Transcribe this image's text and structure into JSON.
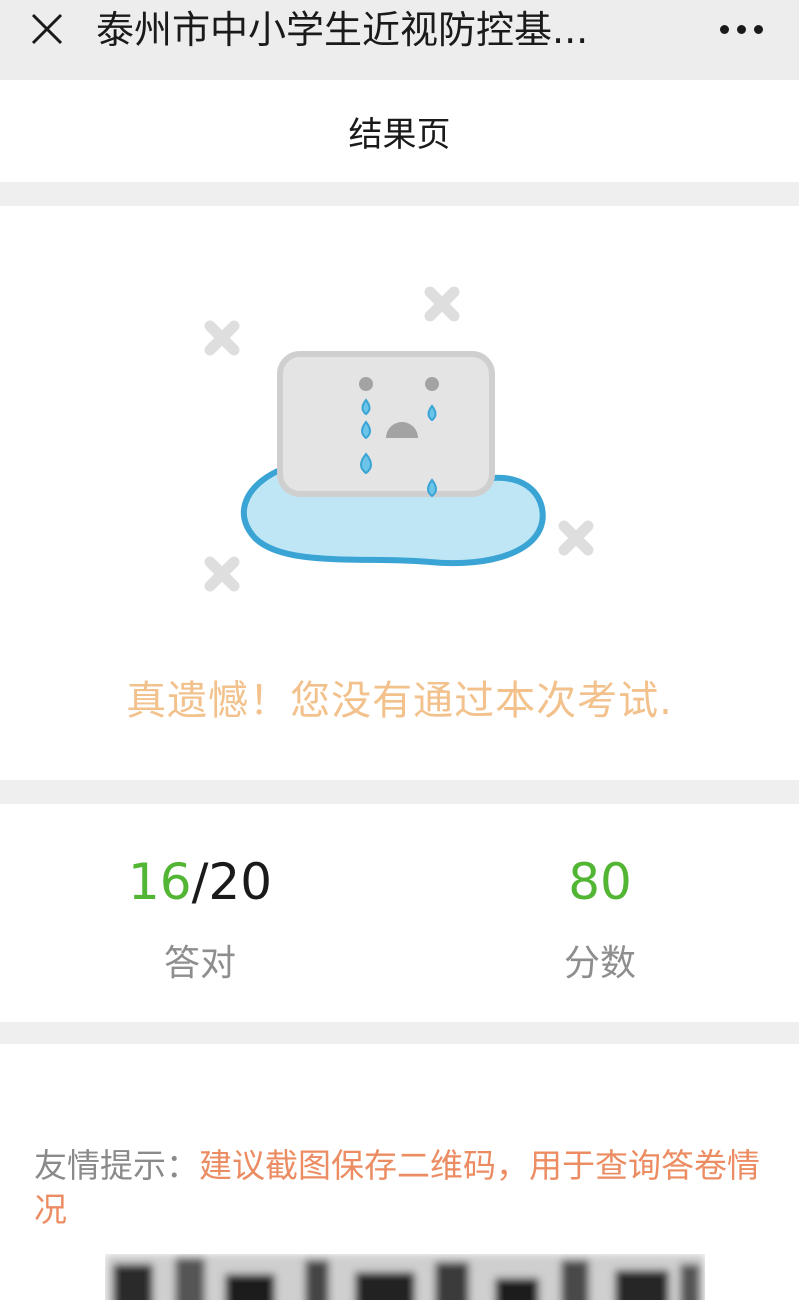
{
  "window": {
    "title": "泰州市中小学生近视防控基..."
  },
  "nav": {
    "title": "结果页"
  },
  "result": {
    "message": "真遗憾！您没有通过本次考试."
  },
  "stats": {
    "correct": {
      "got": "16",
      "separator": "/",
      "total": "20",
      "label": "答对"
    },
    "score": {
      "value": "80",
      "label": "分数"
    }
  },
  "tip": {
    "label": "友情提示：",
    "body": "建议截图保存二维码，用于查询答卷情况"
  },
  "colors": {
    "accent_green": "#52b534",
    "message_orange": "#f2c18c",
    "tip_orange": "#ec8c62",
    "puddle_blue": "#bfe6f5"
  },
  "icons": {
    "close": "close-icon",
    "more": "more-icon",
    "illustration": "crying-face-icon"
  }
}
